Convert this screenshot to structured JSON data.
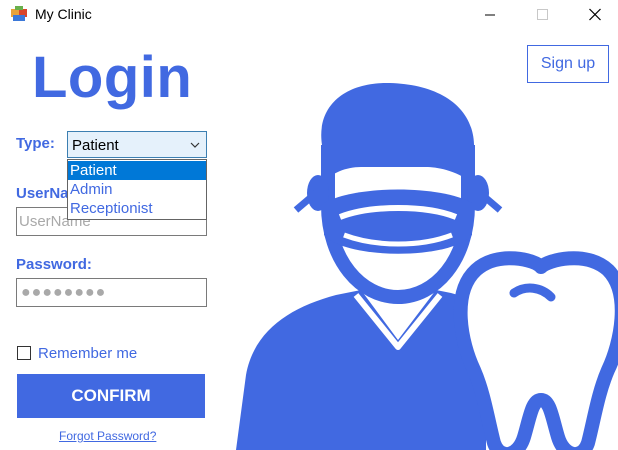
{
  "window": {
    "title": "My Clinic",
    "icons": {
      "app": "app-icon",
      "minimize": "minimize-icon",
      "maximize": "maximize-icon",
      "close": "close-icon"
    }
  },
  "login": {
    "heading": "Login",
    "signup_label": "Sign up",
    "type": {
      "label": "Type:",
      "selected": "Patient",
      "options": [
        "Patient",
        "Admin",
        "Receptionist"
      ]
    },
    "username": {
      "label": "UserName:",
      "placeholder": "UserName",
      "value": ""
    },
    "password": {
      "label": "Password:",
      "masked_value": "●●●●●●●●"
    },
    "remember": {
      "label": "Remember me",
      "checked": false
    },
    "confirm_label": "CONFIRM",
    "forgot_label": "Forgot Password?"
  },
  "illustration": {
    "icon": "dentist-with-mask-and-tooth-icon"
  },
  "colors": {
    "accent": "#4169e1",
    "selection": "#0078d7",
    "select_bg": "#e5f1fb"
  }
}
